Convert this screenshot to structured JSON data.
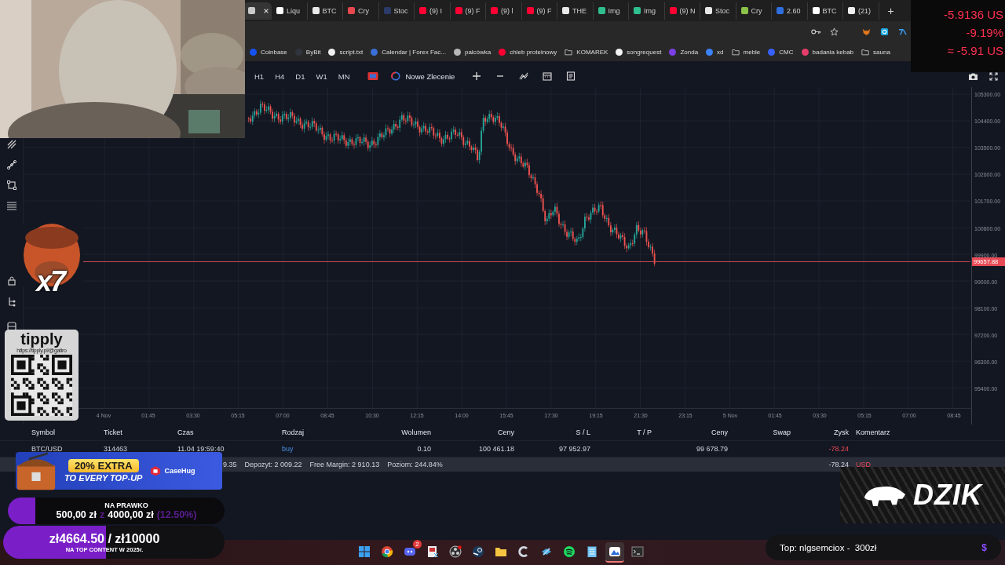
{
  "browser": {
    "tabs": [
      {
        "selected": true,
        "color": "#c9c9c9"
      },
      {
        "label": "Liqu",
        "selected": false,
        "color": "#ffffff"
      },
      {
        "label": "BTC",
        "selected": false,
        "color": "#e8e8e8"
      },
      {
        "label": "Cry",
        "selected": false,
        "color": "#e5484d"
      },
      {
        "label": "Stoc",
        "selected": false,
        "color": "#2b3a67"
      },
      {
        "label": "(9) I",
        "selected": false,
        "color": "#ff0033"
      },
      {
        "label": "(9) F",
        "selected": false,
        "color": "#ff0033"
      },
      {
        "label": "(9) l",
        "selected": false,
        "color": "#ff0033"
      },
      {
        "label": "(9) F",
        "selected": false,
        "color": "#ff0033"
      },
      {
        "label": "THE",
        "selected": false,
        "color": "#e8e8e8"
      },
      {
        "label": "Img",
        "selected": false,
        "color": "#2fbf8f"
      },
      {
        "label": "Img",
        "selected": false,
        "color": "#2fbf8f"
      },
      {
        "label": "(9) N",
        "selected": false,
        "color": "#ff0033"
      },
      {
        "label": "Stoc",
        "selected": false,
        "color": "#e8e8e8"
      },
      {
        "label": "Cry",
        "selected": false,
        "color": "#8bc34a"
      },
      {
        "label": "2.60",
        "selected": false,
        "color": "#2f6fe0"
      },
      {
        "label": "BTC",
        "selected": false,
        "color": "#ffffff"
      },
      {
        "label": "(21)",
        "selected": false,
        "color": "#f0f0f0"
      }
    ],
    "new_tab": "+",
    "bookmarks": [
      {
        "label": "Coinbase",
        "kind": "site",
        "color": "#1652f0"
      },
      {
        "label": "ByBit",
        "kind": "site",
        "color": "#30343c"
      },
      {
        "label": "script.txt",
        "kind": "site",
        "color": "#f0f0f0"
      },
      {
        "label": "Calendar | Forex Fac...",
        "kind": "site",
        "color": "#3a6fd8"
      },
      {
        "label": "palcówka",
        "kind": "site",
        "color": "#b8b8b8"
      },
      {
        "label": "chleb proteinowy",
        "kind": "site",
        "color": "#ff0033"
      },
      {
        "label": "KOMAREK",
        "kind": "folder"
      },
      {
        "label": "songrequest",
        "kind": "site",
        "color": "#f5f5f5"
      },
      {
        "label": "Zonda",
        "kind": "site",
        "color": "#7b3fe4"
      },
      {
        "label": "xd",
        "kind": "site",
        "color": "#3b82f6"
      },
      {
        "label": "meble",
        "kind": "folder"
      },
      {
        "label": "CMC",
        "kind": "site",
        "color": "#3861fb"
      },
      {
        "label": "badania kebab",
        "kind": "site",
        "color": "#e53e6a"
      },
      {
        "label": "sauna",
        "kind": "folder"
      }
    ]
  },
  "toolbar": {
    "timeframes": [
      "H1",
      "H4",
      "D1",
      "W1",
      "MN"
    ],
    "new_order": "Nowe Zlecenie"
  },
  "chart": {
    "price_ticks": [
      "105300.00",
      "104400.00",
      "103500.00",
      "102600.00",
      "101700.00",
      "100800.00",
      "99900.00",
      "99000.00",
      "98100.00",
      "97200.00",
      "96300.00",
      "95400.00"
    ],
    "current_price": "99657.88",
    "time_ticks": [
      "4 Nov",
      "01:45",
      "03:30",
      "05:15",
      "07:00",
      "08:45",
      "10:30",
      "12:15",
      "14:00",
      "15:45",
      "17:30",
      "19:15",
      "21:30",
      "23:15",
      "5 Nov",
      "01:45",
      "03:30",
      "05:15",
      "07:00",
      "08:45"
    ]
  },
  "table": {
    "columns": [
      {
        "label": "Symbol",
        "kind": "left"
      },
      {
        "label": "Ticket",
        "kind": "left"
      },
      {
        "label": "Czas",
        "kind": "left"
      },
      {
        "label": "Rodzaj",
        "kind": "side"
      },
      {
        "label": "Wolumen",
        "kind": "right"
      },
      {
        "label": "Ceny",
        "kind": "right"
      },
      {
        "label": "S / L",
        "kind": "right"
      },
      {
        "label": "T / P",
        "kind": "right"
      },
      {
        "label": "Ceny",
        "kind": "right"
      },
      {
        "label": "Swap",
        "kind": "right"
      },
      {
        "label": "Zysk",
        "kind": "profit"
      },
      {
        "label": "Komentarz",
        "kind": "left"
      }
    ],
    "rows": [
      [
        "BTC/USD",
        "314463",
        "11.04 19:59:40",
        "buy",
        "0.10",
        "100 461.18",
        "97 952.97",
        null,
        "99 678.79",
        null,
        "-78.24",
        null
      ]
    ],
    "summary": {
      "fragment": "9.35",
      "deposit": "Depozyt: 2 009.22",
      "free_margin": "Free Margin: 2 910.13",
      "margin_level": "Poziom: 244.84%",
      "profit": "-78.24",
      "currency": "USD"
    }
  },
  "taskbar": {
    "apps": [
      {
        "kind": "start",
        "selected": false
      },
      {
        "kind": "browser",
        "selected": false
      },
      {
        "kind": "chat",
        "selected": false,
        "badge": "2"
      },
      {
        "kind": "media",
        "selected": false
      },
      {
        "kind": "recorder",
        "selected": false
      },
      {
        "kind": "steam",
        "selected": false
      },
      {
        "kind": "folder",
        "selected": false
      },
      {
        "kind": "cleaner",
        "selected": false
      },
      {
        "kind": "network",
        "selected": false
      },
      {
        "kind": "music",
        "selected": false
      },
      {
        "kind": "notes",
        "selected": false
      },
      {
        "kind": "photos",
        "selected": true
      },
      {
        "kind": "terminal",
        "selected": false
      }
    ]
  },
  "overlays": {
    "ticker": [
      "-5.9136 US",
      "-9.19%",
      "≈ -5.91 US"
    ],
    "emote_count": "x7",
    "tip_card": {
      "brand": "tipply",
      "url": "https://tipply.pl/@gatiro"
    },
    "promo": {
      "offer": "20% EXTRA",
      "tagline": "TO EVERY TOP-UP",
      "brand": "CaseHug"
    },
    "goals": [
      {
        "title": "NA PRAWKO",
        "raised": "500,00 zł",
        "separator": "z",
        "target": "4000,00 zł",
        "percent": "(12.50%)",
        "level": 0.125
      },
      {
        "amount": "zł4664.50 / zł10000",
        "title": "NA TOP CONTENT W 2025r.",
        "level": 0.466
      }
    ],
    "sponsor": "DZIK",
    "top_donor": {
      "text": "Top: nlgsemciox -  300zł",
      "symbol": "$"
    }
  }
}
